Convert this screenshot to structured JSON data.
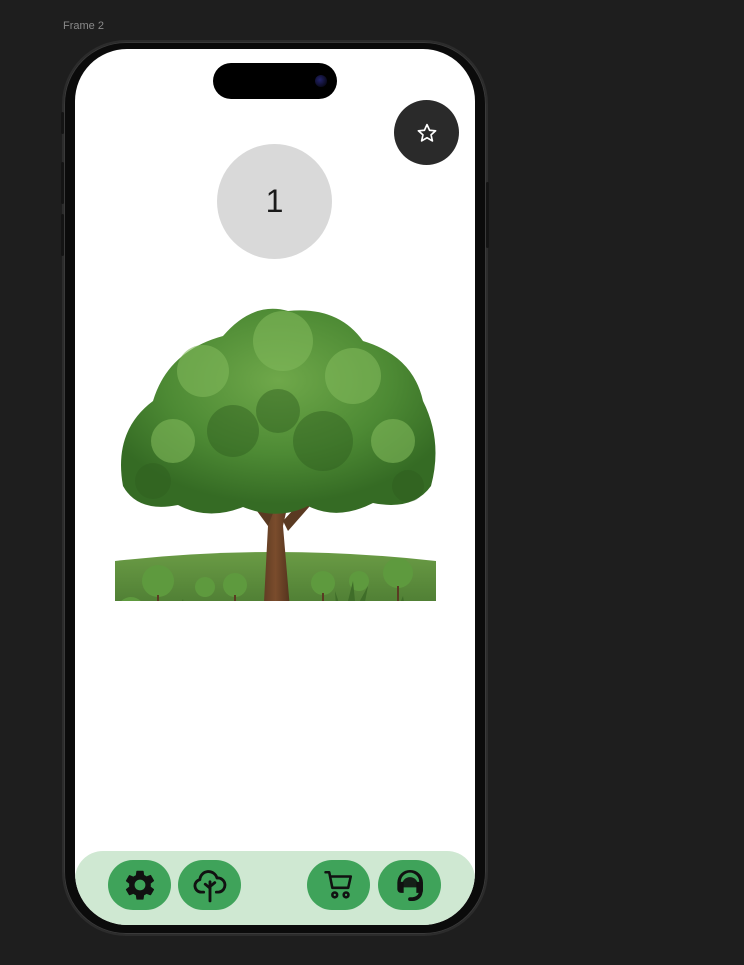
{
  "canvas": {
    "frame_label": "Frame 2"
  },
  "screen": {
    "counter_value": "1",
    "favorite_icon": "star-icon",
    "main_image": "tree-illustration"
  },
  "bottom_nav": {
    "items": [
      {
        "icon": "gear-icon"
      },
      {
        "icon": "tree-icon"
      },
      {
        "icon": "cart-icon"
      },
      {
        "icon": "support-headset-icon"
      }
    ]
  },
  "colors": {
    "nav_background": "#cfe8d2",
    "nav_button": "#3fa35a",
    "favorite_button": "#2a2a2a",
    "counter_circle": "#d9d9d9",
    "canvas_background": "#1e1e1e"
  }
}
